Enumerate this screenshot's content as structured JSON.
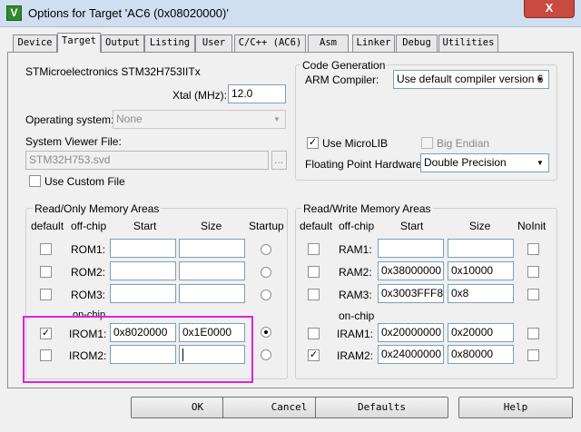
{
  "window": {
    "title": "Options for Target 'AC6 (0x08020000)'",
    "app_icon": "V",
    "close_glyph": "X"
  },
  "tabs": [
    "Device",
    "Target",
    "Output",
    "Listing",
    "User",
    "C/C++ (AC6)",
    "Asm",
    "Linker",
    "Debug",
    "Utilities"
  ],
  "active_tab": "Target",
  "device_name": "STMicroelectronics STM32H753IITx",
  "xtal": {
    "label": "Xtal (MHz):",
    "value": "12.0"
  },
  "os": {
    "label": "Operating system:",
    "value": "None"
  },
  "svf": {
    "label": "System Viewer File:",
    "value": "STM32H753.svd",
    "browse": "..."
  },
  "custom_file": {
    "label": "Use Custom File",
    "checked": false
  },
  "code_gen": {
    "title": "Code Generation",
    "compiler_label": "ARM Compiler:",
    "compiler_value": "Use default compiler version 6",
    "microlib_label": "Use MicroLIB",
    "microlib_checked": true,
    "big_endian_label": "Big Endian",
    "fp_label": "Floating Point Hardware:",
    "fp_value": "Double Precision"
  },
  "ro_area": {
    "title": "Read/Only Memory Areas",
    "headers": {
      "default": "default",
      "offchip": "off-chip",
      "start": "Start",
      "size": "Size",
      "startup": "Startup"
    },
    "onchip_label": "on-chip",
    "rows": [
      {
        "name": "ROM1:",
        "default": false,
        "start": "",
        "size": "",
        "startup": false
      },
      {
        "name": "ROM2:",
        "default": false,
        "start": "",
        "size": "",
        "startup": false
      },
      {
        "name": "ROM3:",
        "default": false,
        "start": "",
        "size": "",
        "startup": false
      },
      {
        "name": "IROM1:",
        "default": true,
        "start": "0x8020000",
        "size": "0x1E0000",
        "startup": true
      },
      {
        "name": "IROM2:",
        "default": false,
        "start": "",
        "size": "",
        "startup": false
      }
    ]
  },
  "rw_area": {
    "title": "Read/Write Memory Areas",
    "headers": {
      "default": "default",
      "offchip": "off-chip",
      "start": "Start",
      "size": "Size",
      "noinit": "NoInit"
    },
    "onchip_label": "on-chip",
    "rows": [
      {
        "name": "RAM1:",
        "default": false,
        "start": "",
        "size": "",
        "noinit": false
      },
      {
        "name": "RAM2:",
        "default": false,
        "start": "0x38000000",
        "size": "0x10000",
        "noinit": false
      },
      {
        "name": "RAM3:",
        "default": false,
        "start": "0x3003FFF8",
        "size": "0x8",
        "noinit": false
      },
      {
        "name": "IRAM1:",
        "default": false,
        "start": "0x20000000",
        "size": "0x20000",
        "noinit": false
      },
      {
        "name": "IRAM2:",
        "default": true,
        "start": "0x24000000",
        "size": "0x80000",
        "noinit": false
      }
    ]
  },
  "buttons": {
    "ok": "OK",
    "cancel": "Cancel",
    "defaults": "Defaults",
    "help": "Help"
  },
  "check_glyph": "✓",
  "dropdown_glyph": "▼",
  "highlight_color": "#e020e0"
}
